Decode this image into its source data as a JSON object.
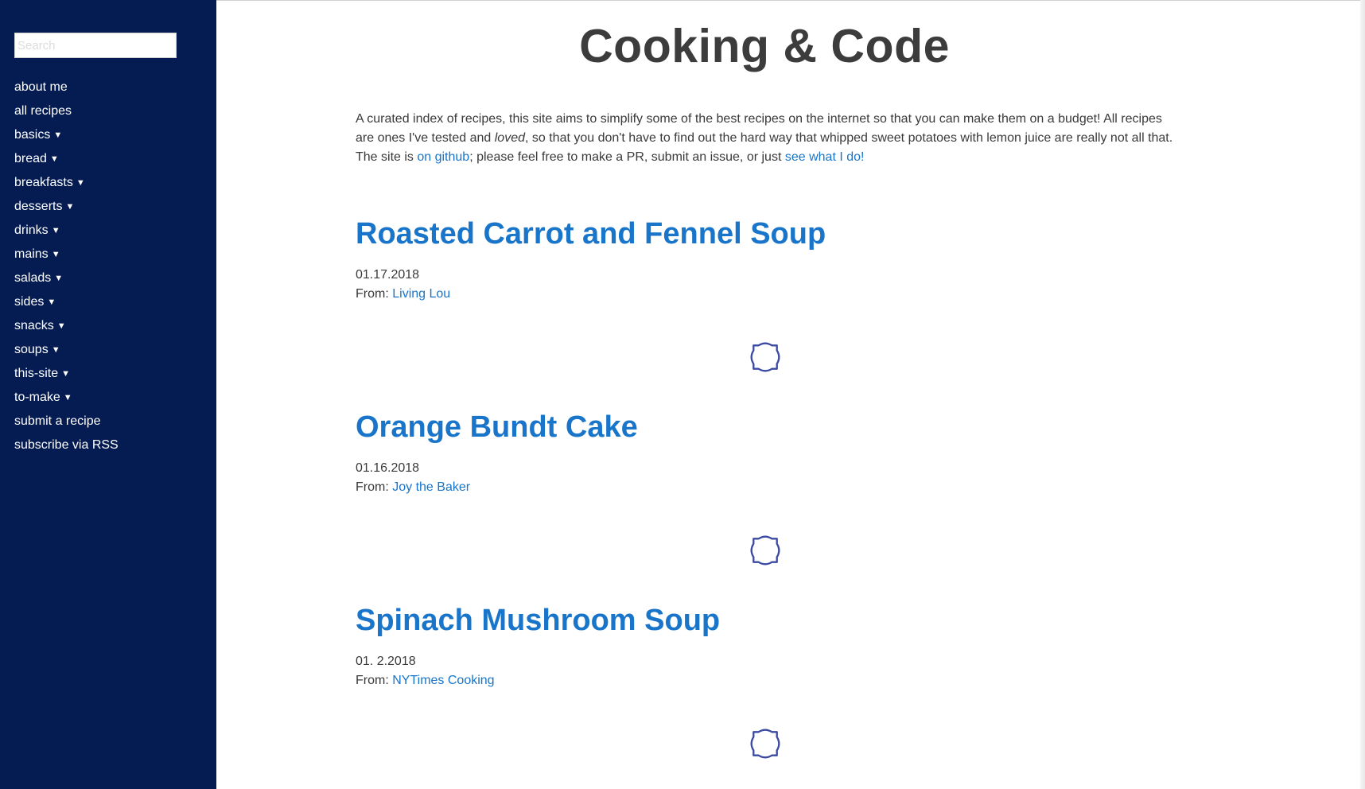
{
  "sidebar": {
    "search_placeholder": "Search",
    "items": [
      {
        "label": "about me",
        "caret": ""
      },
      {
        "label": "all recipes",
        "caret": ""
      },
      {
        "label": "basics",
        "caret": "▼"
      },
      {
        "label": "bread",
        "caret": "▼"
      },
      {
        "label": "breakfasts",
        "caret": "▼"
      },
      {
        "label": "desserts",
        "caret": "▼"
      },
      {
        "label": "drinks",
        "caret": "▼"
      },
      {
        "label": "mains",
        "caret": "▼"
      },
      {
        "label": "salads",
        "caret": "▼"
      },
      {
        "label": "sides",
        "caret": "▼"
      },
      {
        "label": "snacks",
        "caret": "▼"
      },
      {
        "label": "soups",
        "caret": "▼"
      },
      {
        "label": "this-site",
        "caret": "▼"
      },
      {
        "label": "to-make",
        "caret": "▼"
      },
      {
        "label": "submit a recipe",
        "caret": ""
      },
      {
        "label": "subscribe via RSS",
        "caret": ""
      }
    ]
  },
  "header": {
    "title": "Cooking & Code"
  },
  "intro": {
    "part1": "A curated index of recipes, this site aims to simplify some of the best recipes on the internet so that you can make them on a budget! All recipes are ones I've tested and ",
    "emphasis": "loved",
    "part2": ", so that you don't have to find out the hard way that whipped sweet potatoes with lemon juice are really not all that. The site is ",
    "github_link": "on github",
    "part3": "; please feel free to make a PR, submit an issue, or just ",
    "see_link": "see what I do!"
  },
  "posts": [
    {
      "title": "Roasted Carrot and Fennel Soup",
      "date": "01.17.2018",
      "from_label": "From:",
      "source": "Living Lou"
    },
    {
      "title": "Orange Bundt Cake",
      "date": "01.16.2018",
      "from_label": "From:",
      "source": "Joy the Baker"
    },
    {
      "title": "Spinach Mushroom Soup",
      "date": "01. 2.2018",
      "from_label": "From:",
      "source": "NYTimes Cooking"
    }
  ],
  "ornament_icon": "ornamental-divider-icon",
  "colors": {
    "sidebar_bg": "#051c52",
    "link": "#1975c9",
    "title": "#3c3c3c",
    "ornament": "#3a4aa3"
  }
}
